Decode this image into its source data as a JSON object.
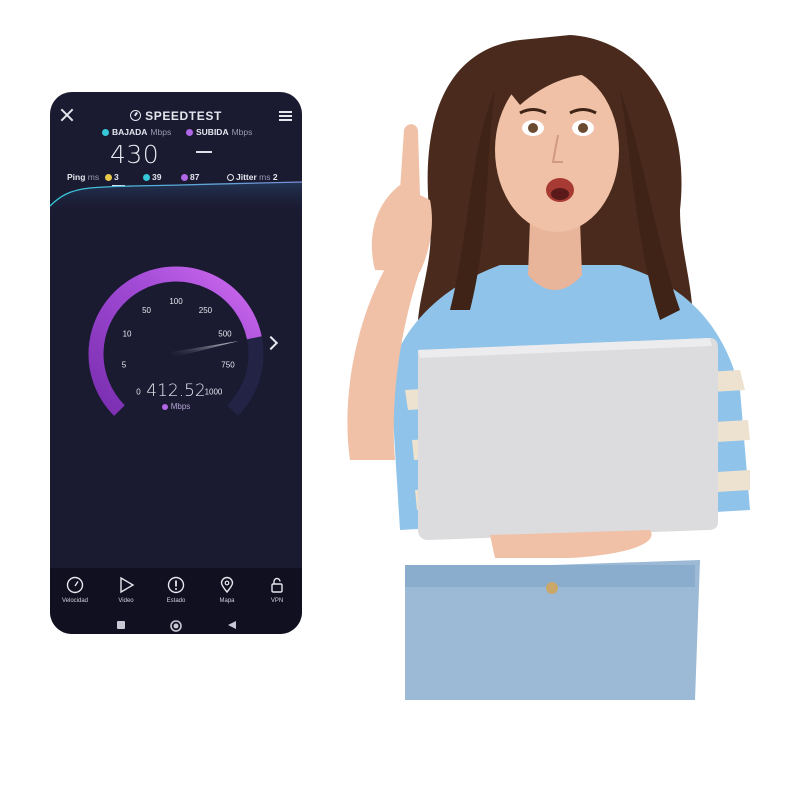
{
  "app": {
    "title": "SPEEDTEST",
    "icons": {
      "close": "close-icon",
      "menu": "hamburger-menu-icon",
      "logo": "speedometer-icon"
    }
  },
  "download": {
    "label": "BAJADA",
    "unit": "Mbps",
    "value": "430",
    "icon": "download-arrow-icon"
  },
  "upload": {
    "label": "SUBIDA",
    "unit": "Mbps",
    "value": "—",
    "icon": "upload-arrow-icon"
  },
  "ping": {
    "label": "Ping",
    "unit": "ms",
    "idle": "3",
    "download": "39",
    "upload": "87",
    "jitter_label": "Jitter",
    "jitter_unit": "ms",
    "jitter": "2"
  },
  "gauge": {
    "ticks": [
      "0",
      "5",
      "10",
      "50",
      "100",
      "250",
      "500",
      "750",
      "1000"
    ],
    "reading": "412.52",
    "unit": "Mbps",
    "fill_fraction": 0.79
  },
  "nav": {
    "items": [
      {
        "label": "Velocidad",
        "icon": "speedometer-icon"
      },
      {
        "label": "Video",
        "icon": "play-icon"
      },
      {
        "label": "Estado",
        "icon": "alert-icon"
      },
      {
        "label": "Mapa",
        "icon": "map-pin-icon"
      },
      {
        "label": "VPN",
        "icon": "lock-icon"
      }
    ]
  },
  "colors": {
    "phone_bg": "#1a1a31",
    "accent_purple": "#b067e6",
    "accent_cyan": "#35c8d8",
    "text_light": "#e6e6ee"
  }
}
